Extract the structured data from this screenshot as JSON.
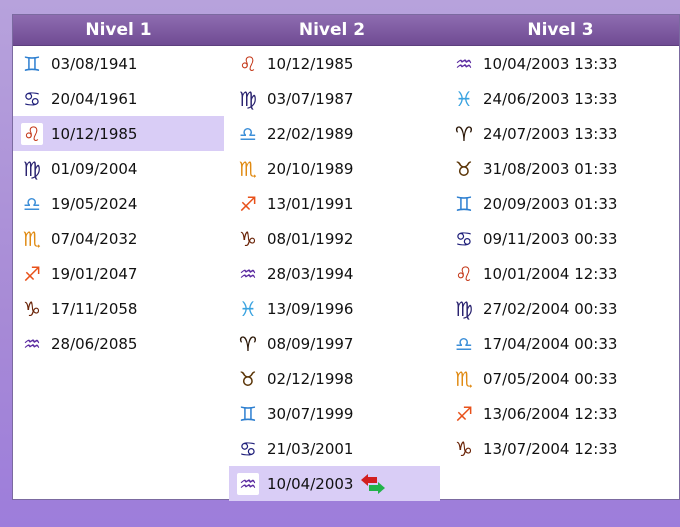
{
  "headers": [
    "Nivel 1",
    "Nivel 2",
    "Nivel 3"
  ],
  "colors": {
    "gemini": "#2d7fd0",
    "cancer": "#1f1f7a",
    "leo": "#c4391a",
    "virgo": "#2b2470",
    "libra": "#3d8fd8",
    "scorpio": "#e08a12",
    "sagittarius": "#e8511a",
    "capricorn": "#6a2408",
    "aquarius": "#5a2aa0",
    "pisces": "#3aa3e0",
    "aries": "#2a1606",
    "taurus": "#5a3406",
    "arrow_red": "#d21f1f",
    "arrow_green": "#22b34a"
  },
  "col1": [
    {
      "sign": "gemini",
      "glyph": "♊",
      "text": "03/08/1941"
    },
    {
      "sign": "cancer",
      "glyph": "♋",
      "text": "20/04/1961"
    },
    {
      "sign": "leo",
      "glyph": "♌",
      "text": "10/12/1985",
      "selected": true
    },
    {
      "sign": "virgo",
      "glyph": "♍",
      "text": "01/09/2004"
    },
    {
      "sign": "libra",
      "glyph": "♎",
      "text": "19/05/2024"
    },
    {
      "sign": "scorpio",
      "glyph": "♏",
      "text": "07/04/2032"
    },
    {
      "sign": "sagittarius",
      "glyph": "♐",
      "text": "19/01/2047"
    },
    {
      "sign": "capricorn",
      "glyph": "♑",
      "text": "17/11/2058"
    },
    {
      "sign": "aquarius",
      "glyph": "♒",
      "text": "28/06/2085"
    }
  ],
  "col2": [
    {
      "sign": "leo",
      "glyph": "♌",
      "text": "10/12/1985"
    },
    {
      "sign": "virgo",
      "glyph": "♍",
      "text": "03/07/1987"
    },
    {
      "sign": "libra",
      "glyph": "♎",
      "text": "22/02/1989"
    },
    {
      "sign": "scorpio",
      "glyph": "♏",
      "text": "20/10/1989"
    },
    {
      "sign": "sagittarius",
      "glyph": "♐",
      "text": "13/01/1991"
    },
    {
      "sign": "capricorn",
      "glyph": "♑",
      "text": "08/01/1992"
    },
    {
      "sign": "aquarius",
      "glyph": "♒",
      "text": "28/03/1994"
    },
    {
      "sign": "pisces",
      "glyph": "♓",
      "text": "13/09/1996"
    },
    {
      "sign": "aries",
      "glyph": "♈",
      "text": "08/09/1997"
    },
    {
      "sign": "taurus",
      "glyph": "♉",
      "text": "02/12/1998"
    },
    {
      "sign": "gemini",
      "glyph": "♊",
      "text": "30/07/1999"
    },
    {
      "sign": "cancer",
      "glyph": "♋",
      "text": "21/03/2001"
    },
    {
      "sign": "aquarius",
      "glyph": "♒",
      "text": "10/04/2003",
      "selected": true,
      "arrows": true
    }
  ],
  "col3": [
    {
      "sign": "aquarius",
      "glyph": "♒",
      "text": "10/04/2003 13:33"
    },
    {
      "sign": "pisces",
      "glyph": "♓",
      "text": "24/06/2003 13:33"
    },
    {
      "sign": "aries",
      "glyph": "♈",
      "text": "24/07/2003 13:33"
    },
    {
      "sign": "taurus",
      "glyph": "♉",
      "text": "31/08/2003 01:33"
    },
    {
      "sign": "gemini",
      "glyph": "♊",
      "text": "20/09/2003 01:33"
    },
    {
      "sign": "cancer",
      "glyph": "♋",
      "text": "09/11/2003 00:33"
    },
    {
      "sign": "leo",
      "glyph": "♌",
      "text": "10/01/2004 12:33"
    },
    {
      "sign": "virgo",
      "glyph": "♍",
      "text": "27/02/2004 00:33"
    },
    {
      "sign": "libra",
      "glyph": "♎",
      "text": "17/04/2004 00:33"
    },
    {
      "sign": "scorpio",
      "glyph": "♏",
      "text": "07/05/2004 00:33"
    },
    {
      "sign": "sagittarius",
      "glyph": "♐",
      "text": "13/06/2004 12:33"
    },
    {
      "sign": "capricorn",
      "glyph": "♑",
      "text": "13/07/2004 12:33"
    }
  ]
}
